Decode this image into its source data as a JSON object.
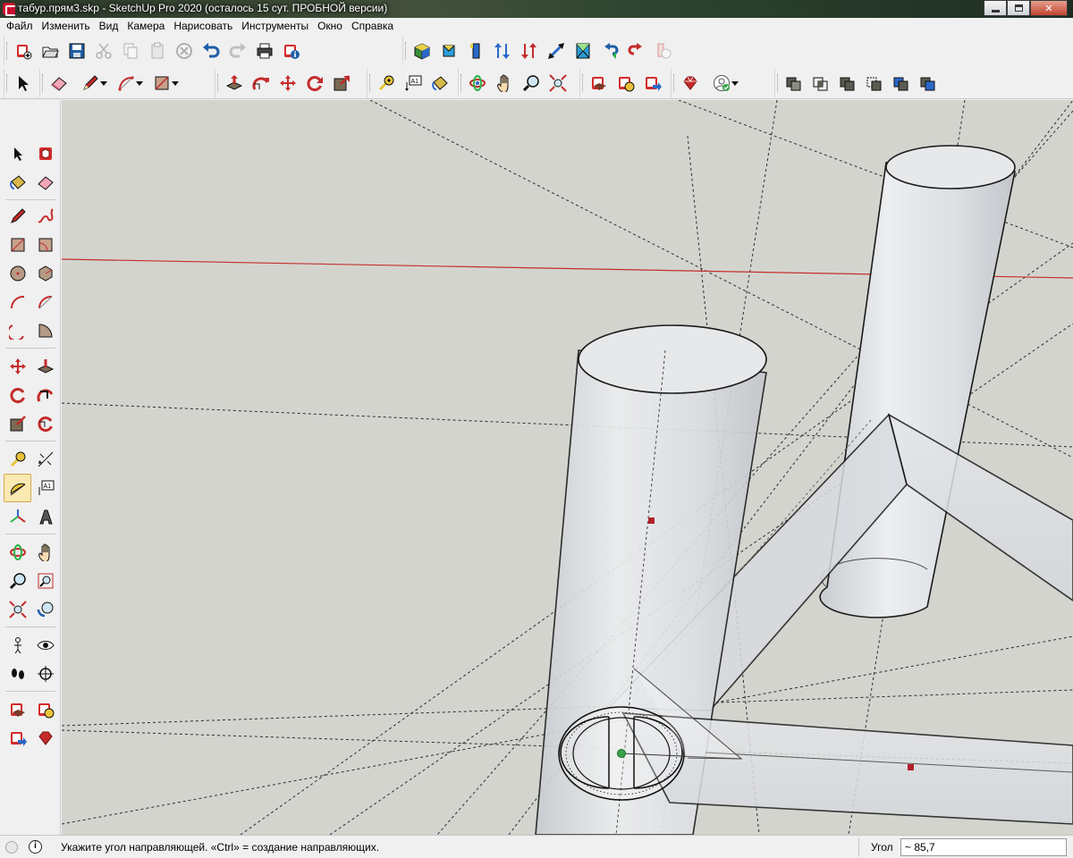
{
  "window": {
    "title": "табур.прям3.skp - SketchUp Pro 2020 (осталось 15 сут. ПРОБНОЙ версии)",
    "minimize_icon": "minimize-icon",
    "restore_icon": "restore-icon",
    "close_icon": "close-icon"
  },
  "menu": {
    "items": [
      {
        "label": "Файл"
      },
      {
        "label": "Изменить"
      },
      {
        "label": "Вид"
      },
      {
        "label": "Камера"
      },
      {
        "label": "Нарисовать"
      },
      {
        "label": "Инструменты"
      },
      {
        "label": "Окно"
      },
      {
        "label": "Справка"
      }
    ]
  },
  "toolbar_top": {
    "standard": [
      "new-file-icon",
      "open-folder-icon",
      "save-icon",
      "cut-icon",
      "copy-icon",
      "paste-icon",
      "erase-icon",
      "undo-icon",
      "redo-icon",
      "print-icon",
      "model-info-icon"
    ],
    "views": [
      "iso-view-icon",
      "top-view-icon",
      "front-view-icon",
      "right-view-icon",
      "back-view-icon",
      "left-view-icon",
      "zoom-extents-icon",
      "section-plane-icon",
      "undo-view-icon",
      "redo-view-icon",
      "match-photo-icon"
    ]
  },
  "toolbar_second": {
    "tools": [
      "select-icon",
      "eraser-icon",
      "pencil-icon",
      "arc-icon",
      "rectangle-icon",
      "push-pull-icon",
      "follow-me-icon",
      "move-icon",
      "rotate-icon",
      "scale-icon",
      "tape-measure-icon",
      "text-icon",
      "paint-bucket-icon",
      "orbit-icon",
      "pan-icon",
      "zoom-icon",
      "zoom-extents-icon",
      "3d-warehouse-icon",
      "extension-warehouse-icon",
      "share-model-icon",
      "ruby-console-icon",
      "account-icon",
      "solid-union-icon",
      "solid-intersect-icon",
      "solid-subtract-icon",
      "solid-trim-icon",
      "solid-split-icon",
      "solid-outer-shell-icon"
    ]
  },
  "left_toolbar": {
    "tools": [
      "select-icon",
      "make-component-icon",
      "paint-bucket-icon",
      "eraser-icon",
      "pencil-icon",
      "freehand-icon",
      "rectangle-icon",
      "rotated-rectangle-icon",
      "circle-icon",
      "polygon-icon",
      "arc-icon",
      "2-point-arc-icon",
      "3-point-arc-icon",
      "pie-icon",
      "move-icon",
      "push-pull-icon",
      "rotate-icon",
      "follow-me-icon",
      "scale-icon",
      "offset-icon",
      "tape-measure-icon",
      "dimension-icon",
      "protractor-icon",
      "text-icon",
      "axes-icon",
      "3d-text-icon",
      "orbit-icon",
      "pan-icon",
      "zoom-icon",
      "zoom-window-icon",
      "zoom-extents-icon",
      "previous-view-icon",
      "position-camera-icon",
      "look-around-icon",
      "walk-icon",
      "section-plane-icon",
      "3d-warehouse-icon",
      "extension-manager-icon",
      "share-model-icon",
      "ruby-icon"
    ],
    "selected_tool": "protractor-icon"
  },
  "status": {
    "message": "Укажите угол направляющей.  «Ctrl» = создание направляющих.",
    "vcb_label": "Угол",
    "vcb_value": "~ 85,7"
  },
  "colors": {
    "viewport_bg": "#d4d4cf",
    "axis_red": "#c4302b",
    "guide": "#2b2b2b",
    "geometry_fill": "#e3e5e8",
    "edge": "#1a1a1a"
  }
}
